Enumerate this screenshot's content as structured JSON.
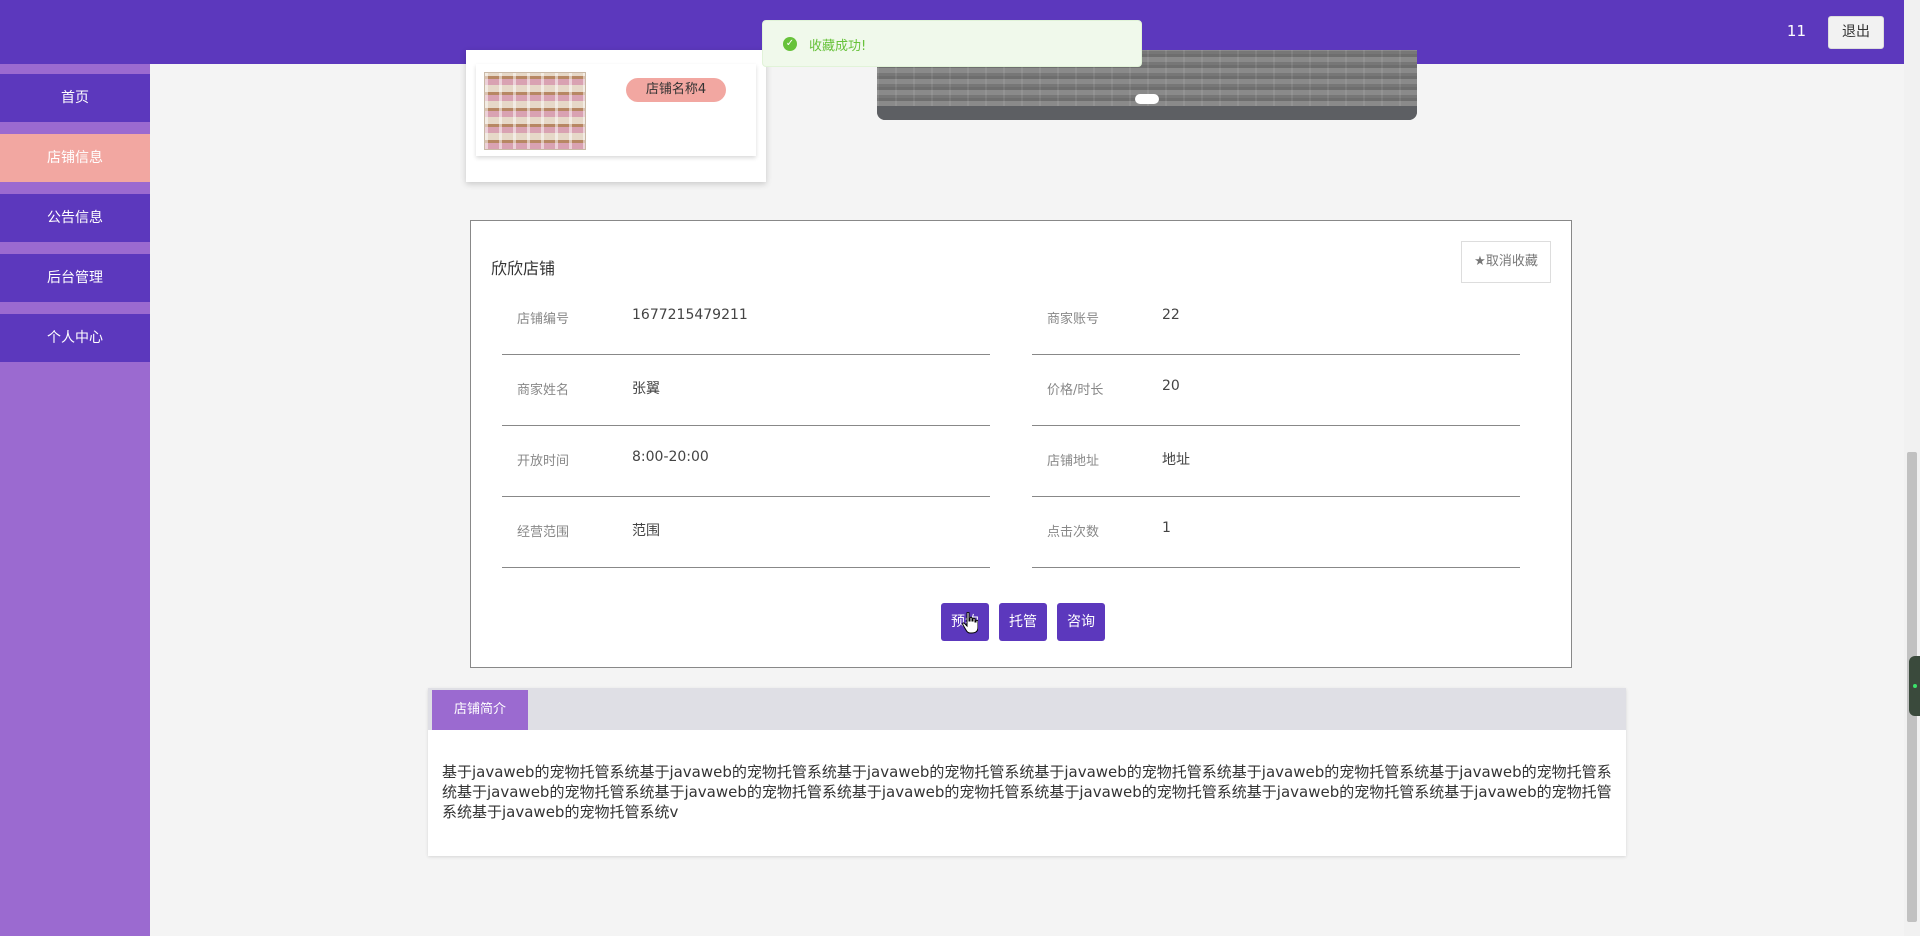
{
  "header": {
    "username": "11",
    "logout_label": "退出"
  },
  "toast": {
    "message": "收藏成功!"
  },
  "sidebar": {
    "items": [
      {
        "label": "首页"
      },
      {
        "label": "店铺信息"
      },
      {
        "label": "公告信息"
      },
      {
        "label": "后台管理"
      },
      {
        "label": "个人中心"
      }
    ]
  },
  "gallery": {
    "thumb_name": "店铺名称4"
  },
  "detail": {
    "title": "欣欣店铺",
    "fav_label": "取消收藏",
    "fields": [
      {
        "label": "店铺编号",
        "value": "1677215479211"
      },
      {
        "label": "商家账号",
        "value": "22"
      },
      {
        "label": "商家姓名",
        "value": "张翼"
      },
      {
        "label": "价格/时长",
        "value": "20"
      },
      {
        "label": "开放时间",
        "value": "8:00-20:00"
      },
      {
        "label": "店铺地址",
        "value": "地址"
      },
      {
        "label": "经营范围",
        "value": "范围"
      },
      {
        "label": "点击次数",
        "value": "1"
      }
    ],
    "buttons": {
      "book": "预约",
      "host": "托管",
      "consult": "咨询"
    }
  },
  "intro": {
    "tab_label": "店铺简介",
    "text": "基于javaweb的宠物托管系统基于javaweb的宠物托管系统基于javaweb的宠物托管系统基于javaweb的宠物托管系统基于javaweb的宠物托管系统基于javaweb的宠物托管系统基于javaweb的宠物托管系统基于javaweb的宠物托管系统基于javaweb的宠物托管系统基于javaweb的宠物托管系统基于javaweb的宠物托管系统基于javaweb的宠物托管系统基于javaweb的宠物托管系统v"
  },
  "colors": {
    "primary": "#5c38bd",
    "sidebar": "#9b6ad0",
    "active": "#f2a7a1",
    "success": "#67c23a"
  }
}
